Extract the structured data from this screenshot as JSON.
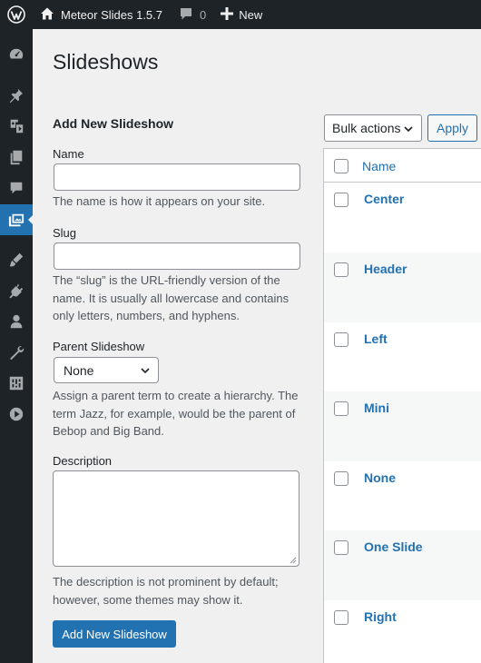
{
  "adminbar": {
    "site_name": "Meteor Slides 1.5.7",
    "comments_count": "0",
    "new_label": "New"
  },
  "sidebar": {
    "icons": [
      "dashboard-icon",
      "pin-icon",
      "media-icon",
      "pages-icon",
      "comments-icon",
      "slides-icon",
      "appearance-icon",
      "plugins-icon",
      "users-icon",
      "tools-icon",
      "settings-icon",
      "play-icon"
    ],
    "current": "slides-icon"
  },
  "page": {
    "title": "Slideshows"
  },
  "form": {
    "title": "Add New Slideshow",
    "name_label": "Name",
    "name_value": "",
    "name_help": "The name is how it appears on your site.",
    "slug_label": "Slug",
    "slug_value": "",
    "slug_help": "The “slug” is the URL-friendly version of the name. It is usually all lowercase and contains only letters, numbers, and hyphens.",
    "parent_label": "Parent Slideshow",
    "parent_value": "None",
    "parent_help": "Assign a parent term to create a hierarchy. The term Jazz, for example, would be the parent of Bebop and Big Band.",
    "description_label": "Description",
    "description_value": "",
    "description_help": "The description is not prominent by default; however, some themes may show it.",
    "submit_label": "Add New Slideshow"
  },
  "list": {
    "bulk_label": "Bulk actions",
    "apply_label": "Apply",
    "column_name": "Name",
    "rows": [
      "Center",
      "Header",
      "Left",
      "Mini",
      "None",
      "One Slide",
      "Right"
    ]
  },
  "colors": {
    "accent": "#2271b1",
    "adminbar_bg": "#1d2327",
    "page_bg": "#f0f0f1"
  }
}
